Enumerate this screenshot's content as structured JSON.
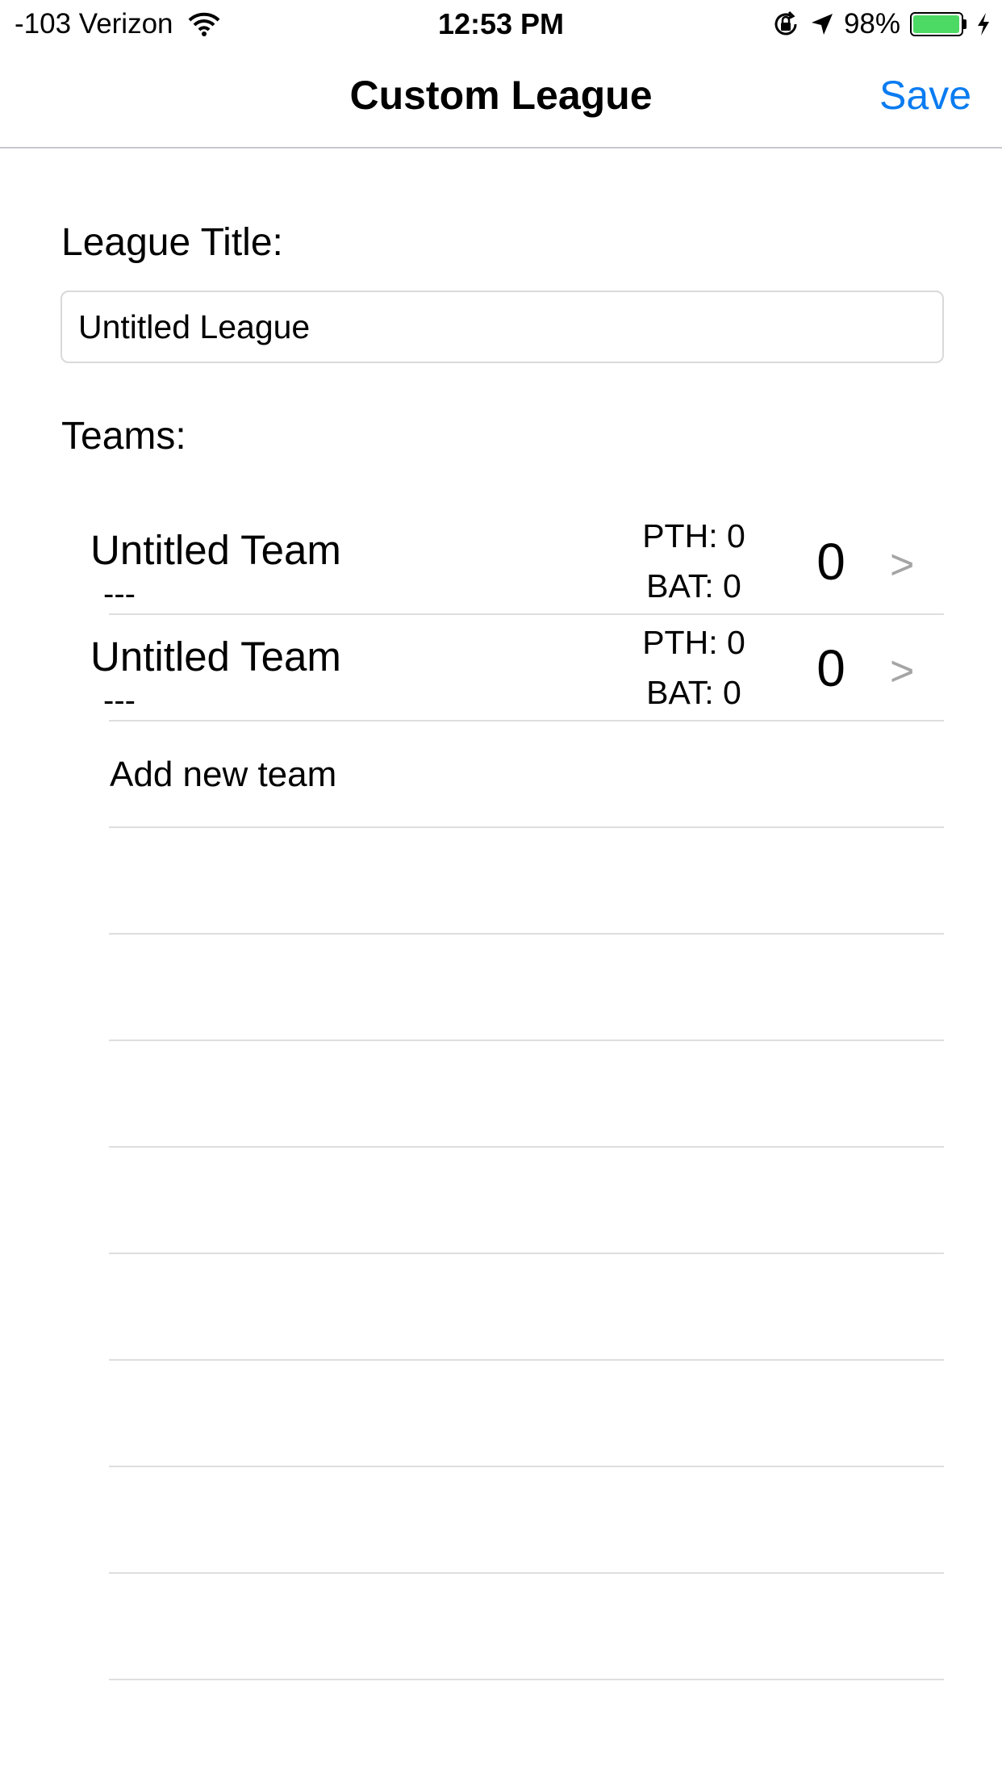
{
  "status_bar": {
    "carrier": "-103 Verizon",
    "time": "12:53 PM",
    "battery_percent": "98%",
    "battery_level": 0.98,
    "battery_color": "#4cd964",
    "icons": [
      "wifi-icon",
      "orientation-lock-icon",
      "location-arrow-icon",
      "battery-icon",
      "charging-bolt-icon"
    ]
  },
  "nav": {
    "title": "Custom League",
    "save_label": "Save",
    "accent_color": "#0a7cf1"
  },
  "form": {
    "league_title_label": "League Title:",
    "league_title_value": "Untitled League",
    "teams_label": "Teams:"
  },
  "teams": [
    {
      "name": "Untitled Team",
      "sub": "---",
      "pth": "PTH: 0",
      "bat": "BAT: 0",
      "score": "0",
      "chevron": ">"
    },
    {
      "name": "Untitled Team",
      "sub": "---",
      "pth": "PTH: 0",
      "bat": "BAT: 0",
      "score": "0",
      "chevron": ">"
    }
  ],
  "add_team_label": "Add new team"
}
